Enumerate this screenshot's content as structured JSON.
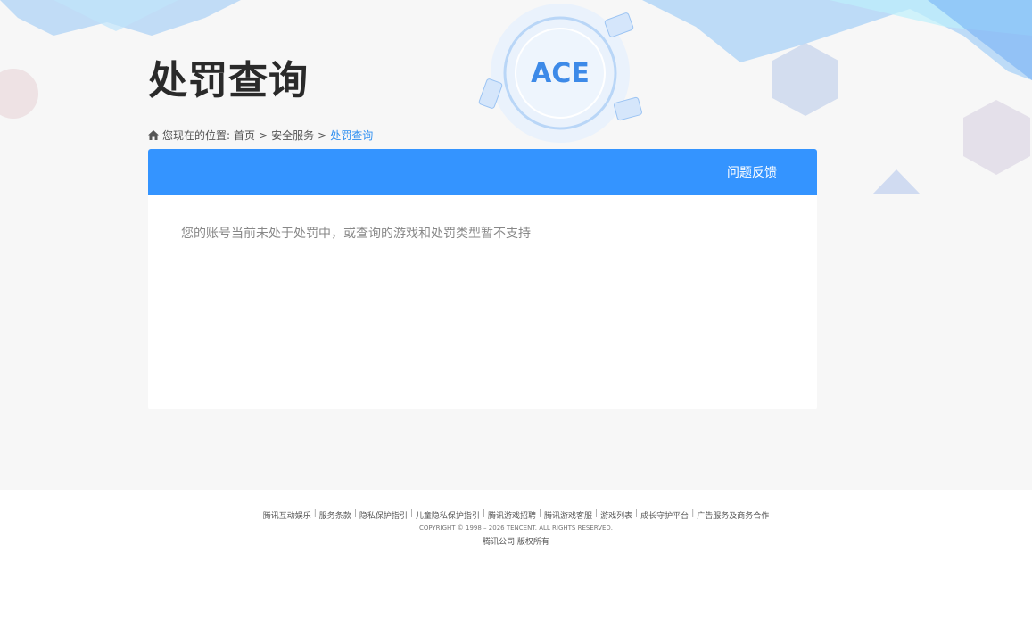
{
  "header": {
    "title": "处罚查询",
    "logo_text": "ACE"
  },
  "breadcrumb": {
    "prefix": "您现在的位置:",
    "items": [
      "首页",
      "安全服务"
    ],
    "current": "处罚查询",
    "separator": ">"
  },
  "card": {
    "feedback_link": "问题反馈",
    "message": "您的账号当前未处于处罚中，或查询的游戏和处罚类型暂不支持"
  },
  "footer": {
    "links": [
      "腾讯互动娱乐",
      "服务条款",
      "隐私保护指引",
      "儿童隐私保护指引",
      "腾讯游戏招聘",
      "腾讯游戏客服",
      "游戏列表",
      "成长守护平台",
      "广告服务及商务合作"
    ],
    "copyright": "COPYRIGHT © 1998 – 2026 TENCENT. ALL RIGHTS RESERVED.",
    "rights": "腾讯公司 版权所有"
  },
  "colors": {
    "accent": "#3494ff",
    "page_bg": "#f7f7f7"
  }
}
